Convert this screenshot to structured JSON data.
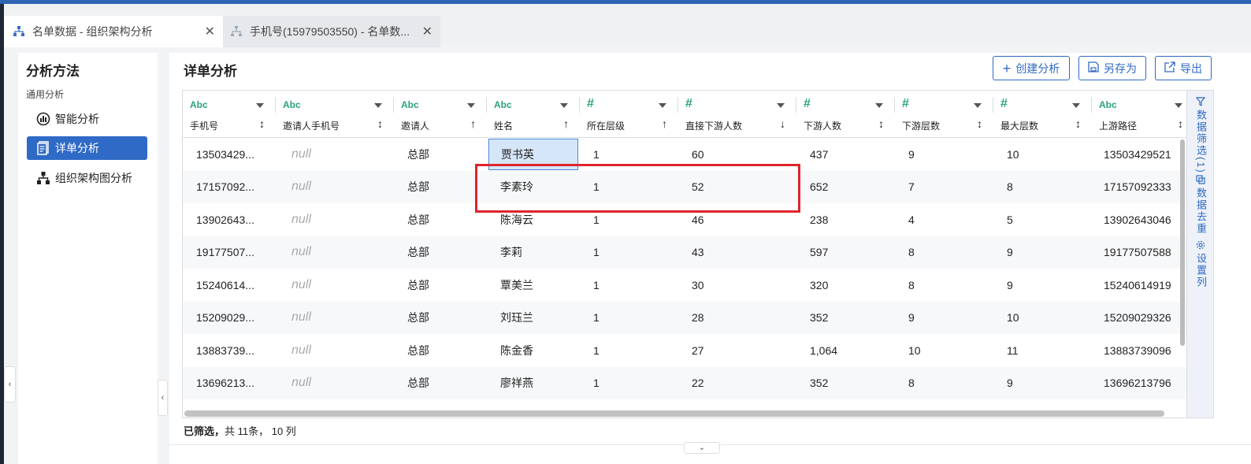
{
  "tabs": [
    {
      "label": "名单数据 - 组织架构分析",
      "icon": "org-chart-icon",
      "active": true
    },
    {
      "label": "手机号(15979503550) - 名单数...",
      "icon": "hierarchy-icon",
      "active": false
    }
  ],
  "sidebar": {
    "title": "分析方法",
    "section": "通用分析",
    "items": [
      {
        "label": "智能分析",
        "icon": "smart-analysis-icon"
      },
      {
        "label": "详单分析",
        "icon": "detail-list-icon",
        "selected": true
      },
      {
        "label": "组织架构图分析",
        "icon": "org-chart-icon"
      }
    ]
  },
  "main": {
    "title": "详单分析",
    "buttons": {
      "create": "创建分析",
      "save_as": "另存为",
      "export": "导出"
    },
    "footer": {
      "filtered": "已筛选，",
      "summary": "共 11条， 10 列"
    }
  },
  "right_panel": {
    "filter": "数据筛选(1)",
    "dedupe": "数据去重",
    "columns": "设置列"
  },
  "table": {
    "columns": [
      {
        "type": "Abc",
        "name": "手机号",
        "sort": "↕"
      },
      {
        "type": "Abc",
        "name": "邀请人手机号",
        "sort": "↕"
      },
      {
        "type": "Abc",
        "name": "邀请人",
        "sort": "↑"
      },
      {
        "type": "Abc",
        "name": "姓名",
        "sort": "↑"
      },
      {
        "type": "#",
        "name": "所在层级",
        "sort": "↑"
      },
      {
        "type": "#",
        "name": "直接下游人数",
        "sort": "↓"
      },
      {
        "type": "#",
        "name": "下游人数",
        "sort": "↕"
      },
      {
        "type": "#",
        "name": "下游层数",
        "sort": "↕"
      },
      {
        "type": "#",
        "name": "最大层数",
        "sort": "↕"
      },
      {
        "type": "Abc",
        "name": "上游路径",
        "sort": "↕"
      }
    ],
    "rows": [
      [
        "13503429...",
        "null",
        "总部",
        "贾书英",
        "1",
        "60",
        "437",
        "9",
        "10",
        "13503429521"
      ],
      [
        "17157092...",
        "null",
        "总部",
        "李素玲",
        "1",
        "52",
        "652",
        "7",
        "8",
        "17157092333"
      ],
      [
        "13902643...",
        "null",
        "总部",
        "陈海云",
        "1",
        "46",
        "238",
        "4",
        "5",
        "13902643046"
      ],
      [
        "19177507...",
        "null",
        "总部",
        "李莉",
        "1",
        "43",
        "597",
        "8",
        "9",
        "19177507588"
      ],
      [
        "15240614...",
        "null",
        "总部",
        "覃美兰",
        "1",
        "30",
        "320",
        "8",
        "9",
        "15240614919"
      ],
      [
        "15209029...",
        "null",
        "总部",
        "刘珏兰",
        "1",
        "28",
        "352",
        "9",
        "10",
        "15209029326"
      ],
      [
        "13883739...",
        "null",
        "总部",
        "陈金香",
        "1",
        "27",
        "1,064",
        "10",
        "11",
        "13883739096"
      ],
      [
        "13696213...",
        "null",
        "总部",
        "廖祥燕",
        "1",
        "22",
        "352",
        "8",
        "9",
        "13696213796"
      ]
    ]
  },
  "colors": {
    "accent": "#2f6ac6",
    "type_green": "#2aa37a",
    "highlight_red": "#e0242b"
  }
}
